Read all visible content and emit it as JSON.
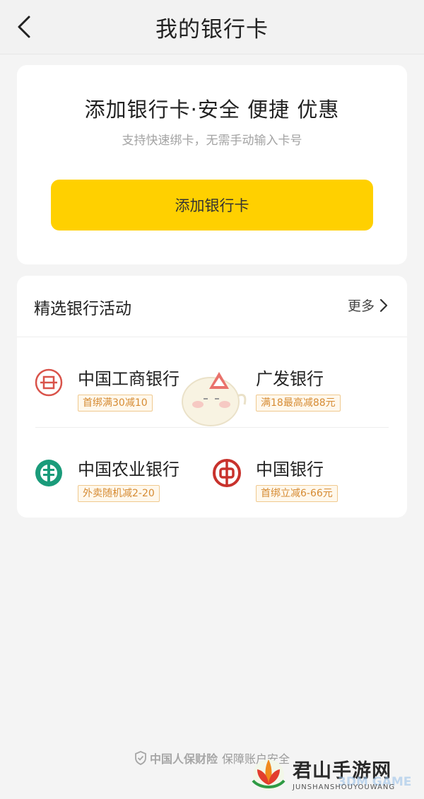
{
  "header": {
    "title": "我的银行卡"
  },
  "add_card": {
    "title": "添加银行卡·安全 便捷 优惠",
    "subtitle": "支持快速绑卡，无需手动输入卡号",
    "button_label": "添加银行卡",
    "button_color": "#ffd000"
  },
  "activities": {
    "title": "精选银行活动",
    "more_label": "更多",
    "banks": [
      {
        "name": "中国工商银行",
        "tag": "首绑满30减10",
        "icon": "icbc-logo-icon",
        "color": "#d9534a"
      },
      {
        "name": "广发银行",
        "tag": "满18最高减88元",
        "icon": "cgb-logo-icon",
        "color": "#e2443a"
      },
      {
        "name": "中国农业银行",
        "tag": "外卖随机减2-20",
        "icon": "abc-logo-icon",
        "color": "#1a9b7a"
      },
      {
        "name": "中国银行",
        "tag": "首绑立减6-66元",
        "icon": "boc-logo-icon",
        "color": "#c8322c"
      }
    ],
    "tag_color": "#d68b33"
  },
  "footer": {
    "brand": "中国人保财险",
    "text": "保障账户安全"
  },
  "watermark": {
    "main": "君山手游网",
    "sub": "JUNSHANSHOUYOUWANG",
    "secondary": "3DM GAME"
  }
}
